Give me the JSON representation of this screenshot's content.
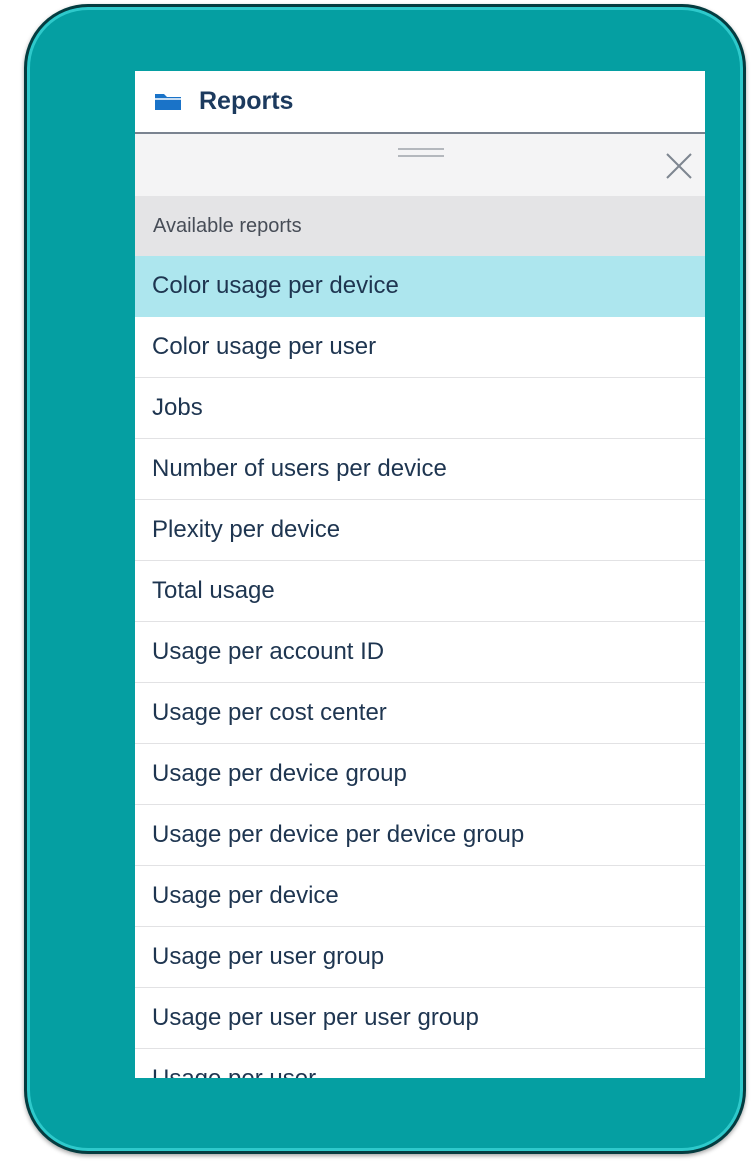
{
  "header": {
    "title": "Reports",
    "icon": "folder-icon",
    "icon_color": "#1a73c8"
  },
  "panel": {
    "section_label": "Available reports",
    "selected_color": "#ade6ee",
    "reports": [
      {
        "label": "Color usage per device",
        "selected": true
      },
      {
        "label": "Color usage per user"
      },
      {
        "label": "Jobs"
      },
      {
        "label": "Number of users per device"
      },
      {
        "label": "Plexity per device"
      },
      {
        "label": "Total usage"
      },
      {
        "label": "Usage per account ID"
      },
      {
        "label": "Usage per cost center"
      },
      {
        "label": "Usage per device group"
      },
      {
        "label": "Usage per device per device group"
      },
      {
        "label": "Usage per device"
      },
      {
        "label": "Usage per user group"
      },
      {
        "label": "Usage per user per user group"
      },
      {
        "label": "Usage per user"
      }
    ]
  },
  "frame_color": "#059fa2"
}
